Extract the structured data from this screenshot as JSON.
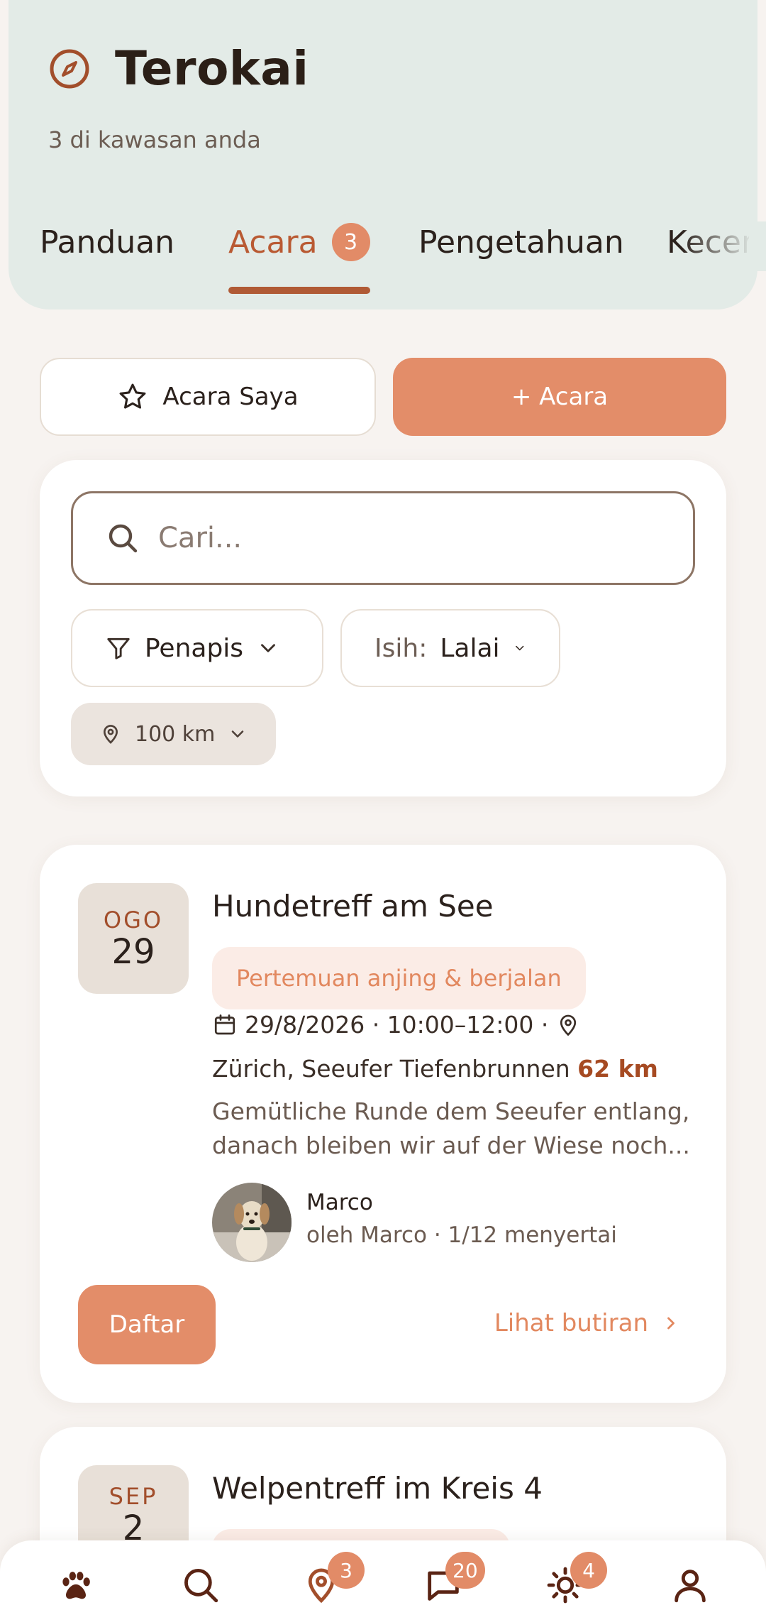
{
  "header": {
    "title": "Terokai",
    "subtitle": "3 di kawasan anda",
    "tabs": [
      {
        "label": "Panduan"
      },
      {
        "label": "Acara",
        "badge": "3"
      },
      {
        "label": "Pengetahuan"
      },
      {
        "label": "Kecen"
      }
    ]
  },
  "actions": {
    "my_events_label": "Acara Saya",
    "add_event_label": "+ Acara"
  },
  "filters": {
    "search_placeholder": "Cari...",
    "filter_label": "Penapis",
    "sort_prefix": "Isih:",
    "sort_value": "Lalai",
    "distance": "100 km"
  },
  "events": [
    {
      "month": "OGO",
      "day": "29",
      "title": "Hundetreff am See",
      "tag": "Pertemuan anjing & berjalan",
      "datetime": "29/8/2026 · 10:00–12:00 ·",
      "location": "Zürich, Seeufer Tiefenbrunnen",
      "distance": "62 km",
      "description": "Gemütliche Runde dem Seeufer entlang, danach bleiben wir auf der Wiese noch...",
      "host_name": "Marco",
      "host_sub": "oleh Marco · 1/12 menyertai",
      "register_label": "Daftar",
      "details_label": "Lihat butiran"
    },
    {
      "month": "SEP",
      "day": "2",
      "title": "Welpentreff im Kreis 4"
    }
  ],
  "bottom_nav": {
    "items": [
      {
        "icon": "paw-icon"
      },
      {
        "icon": "search-icon"
      },
      {
        "icon": "map-pin-icon",
        "badge": "3"
      },
      {
        "icon": "chat-icon",
        "badge": "20"
      },
      {
        "icon": "sun-icon",
        "badge": "4"
      },
      {
        "icon": "user-icon"
      }
    ]
  },
  "colors": {
    "accent": "#e38d69",
    "accent_dark": "#b05a35",
    "header_bg": "#e3ebe7",
    "page_bg": "#f7f3f0"
  }
}
